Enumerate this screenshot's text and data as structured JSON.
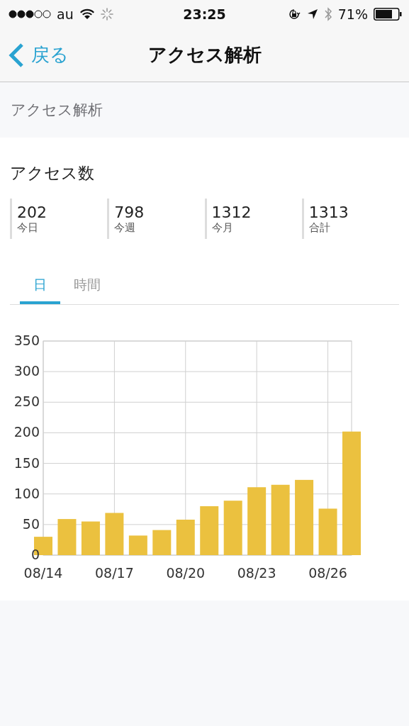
{
  "status_bar": {
    "carrier": "au",
    "time": "23:25",
    "battery": "71%"
  },
  "nav": {
    "back": "戻る",
    "title": "アクセス解析"
  },
  "section_header": "アクセス解析",
  "card": {
    "title": "アクセス数",
    "stats": [
      {
        "value": "202",
        "label": "今日"
      },
      {
        "value": "798",
        "label": "今週"
      },
      {
        "value": "1312",
        "label": "今月"
      },
      {
        "value": "1313",
        "label": "合計"
      }
    ],
    "tabs": [
      {
        "label": "日",
        "selected": true
      },
      {
        "label": "時間",
        "selected": false
      }
    ],
    "chart_data": {
      "type": "bar",
      "categories": [
        "08/14",
        null,
        null,
        "08/17",
        null,
        null,
        "08/20",
        null,
        null,
        "08/23",
        null,
        null,
        "08/26",
        null
      ],
      "grid": true,
      "series": [
        {
          "color": "#ebc13f",
          "values": [
            30,
            59,
            55,
            69,
            32,
            41,
            58,
            80,
            89,
            111,
            115,
            123,
            76,
            202
          ]
        }
      ],
      "ylim": [
        0,
        350
      ],
      "yticks": [
        0,
        50,
        100,
        150,
        200,
        250,
        300,
        350
      ]
    }
  }
}
